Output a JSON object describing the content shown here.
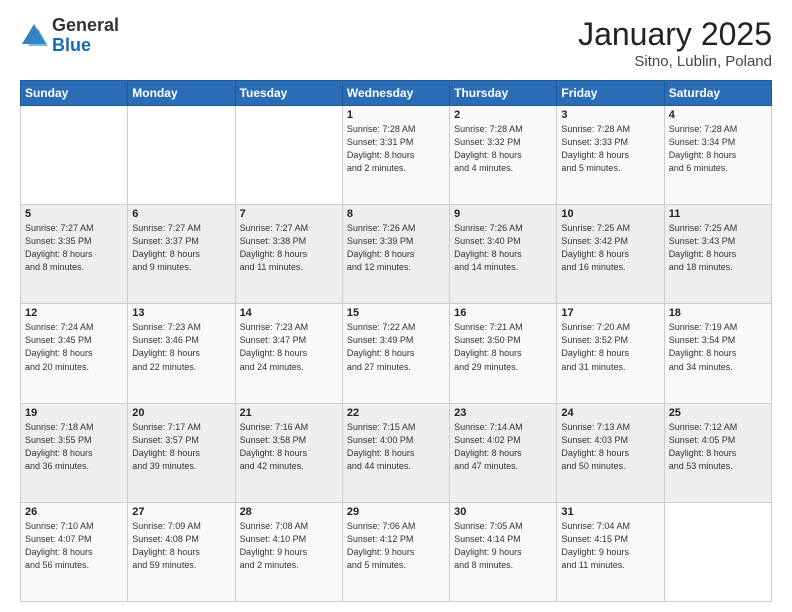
{
  "header": {
    "logo_general": "General",
    "logo_blue": "Blue",
    "month_title": "January 2025",
    "location": "Sitno, Lublin, Poland"
  },
  "days_of_week": [
    "Sunday",
    "Monday",
    "Tuesday",
    "Wednesday",
    "Thursday",
    "Friday",
    "Saturday"
  ],
  "weeks": [
    [
      {
        "day": "",
        "info": ""
      },
      {
        "day": "",
        "info": ""
      },
      {
        "day": "",
        "info": ""
      },
      {
        "day": "1",
        "info": "Sunrise: 7:28 AM\nSunset: 3:31 PM\nDaylight: 8 hours\nand 2 minutes."
      },
      {
        "day": "2",
        "info": "Sunrise: 7:28 AM\nSunset: 3:32 PM\nDaylight: 8 hours\nand 4 minutes."
      },
      {
        "day": "3",
        "info": "Sunrise: 7:28 AM\nSunset: 3:33 PM\nDaylight: 8 hours\nand 5 minutes."
      },
      {
        "day": "4",
        "info": "Sunrise: 7:28 AM\nSunset: 3:34 PM\nDaylight: 8 hours\nand 6 minutes."
      }
    ],
    [
      {
        "day": "5",
        "info": "Sunrise: 7:27 AM\nSunset: 3:35 PM\nDaylight: 8 hours\nand 8 minutes."
      },
      {
        "day": "6",
        "info": "Sunrise: 7:27 AM\nSunset: 3:37 PM\nDaylight: 8 hours\nand 9 minutes."
      },
      {
        "day": "7",
        "info": "Sunrise: 7:27 AM\nSunset: 3:38 PM\nDaylight: 8 hours\nand 11 minutes."
      },
      {
        "day": "8",
        "info": "Sunrise: 7:26 AM\nSunset: 3:39 PM\nDaylight: 8 hours\nand 12 minutes."
      },
      {
        "day": "9",
        "info": "Sunrise: 7:26 AM\nSunset: 3:40 PM\nDaylight: 8 hours\nand 14 minutes."
      },
      {
        "day": "10",
        "info": "Sunrise: 7:25 AM\nSunset: 3:42 PM\nDaylight: 8 hours\nand 16 minutes."
      },
      {
        "day": "11",
        "info": "Sunrise: 7:25 AM\nSunset: 3:43 PM\nDaylight: 8 hours\nand 18 minutes."
      }
    ],
    [
      {
        "day": "12",
        "info": "Sunrise: 7:24 AM\nSunset: 3:45 PM\nDaylight: 8 hours\nand 20 minutes."
      },
      {
        "day": "13",
        "info": "Sunrise: 7:23 AM\nSunset: 3:46 PM\nDaylight: 8 hours\nand 22 minutes."
      },
      {
        "day": "14",
        "info": "Sunrise: 7:23 AM\nSunset: 3:47 PM\nDaylight: 8 hours\nand 24 minutes."
      },
      {
        "day": "15",
        "info": "Sunrise: 7:22 AM\nSunset: 3:49 PM\nDaylight: 8 hours\nand 27 minutes."
      },
      {
        "day": "16",
        "info": "Sunrise: 7:21 AM\nSunset: 3:50 PM\nDaylight: 8 hours\nand 29 minutes."
      },
      {
        "day": "17",
        "info": "Sunrise: 7:20 AM\nSunset: 3:52 PM\nDaylight: 8 hours\nand 31 minutes."
      },
      {
        "day": "18",
        "info": "Sunrise: 7:19 AM\nSunset: 3:54 PM\nDaylight: 8 hours\nand 34 minutes."
      }
    ],
    [
      {
        "day": "19",
        "info": "Sunrise: 7:18 AM\nSunset: 3:55 PM\nDaylight: 8 hours\nand 36 minutes."
      },
      {
        "day": "20",
        "info": "Sunrise: 7:17 AM\nSunset: 3:57 PM\nDaylight: 8 hours\nand 39 minutes."
      },
      {
        "day": "21",
        "info": "Sunrise: 7:16 AM\nSunset: 3:58 PM\nDaylight: 8 hours\nand 42 minutes."
      },
      {
        "day": "22",
        "info": "Sunrise: 7:15 AM\nSunset: 4:00 PM\nDaylight: 8 hours\nand 44 minutes."
      },
      {
        "day": "23",
        "info": "Sunrise: 7:14 AM\nSunset: 4:02 PM\nDaylight: 8 hours\nand 47 minutes."
      },
      {
        "day": "24",
        "info": "Sunrise: 7:13 AM\nSunset: 4:03 PM\nDaylight: 8 hours\nand 50 minutes."
      },
      {
        "day": "25",
        "info": "Sunrise: 7:12 AM\nSunset: 4:05 PM\nDaylight: 8 hours\nand 53 minutes."
      }
    ],
    [
      {
        "day": "26",
        "info": "Sunrise: 7:10 AM\nSunset: 4:07 PM\nDaylight: 8 hours\nand 56 minutes."
      },
      {
        "day": "27",
        "info": "Sunrise: 7:09 AM\nSunset: 4:08 PM\nDaylight: 8 hours\nand 59 minutes."
      },
      {
        "day": "28",
        "info": "Sunrise: 7:08 AM\nSunset: 4:10 PM\nDaylight: 9 hours\nand 2 minutes."
      },
      {
        "day": "29",
        "info": "Sunrise: 7:06 AM\nSunset: 4:12 PM\nDaylight: 9 hours\nand 5 minutes."
      },
      {
        "day": "30",
        "info": "Sunrise: 7:05 AM\nSunset: 4:14 PM\nDaylight: 9 hours\nand 8 minutes."
      },
      {
        "day": "31",
        "info": "Sunrise: 7:04 AM\nSunset: 4:15 PM\nDaylight: 9 hours\nand 11 minutes."
      },
      {
        "day": "",
        "info": ""
      }
    ]
  ]
}
